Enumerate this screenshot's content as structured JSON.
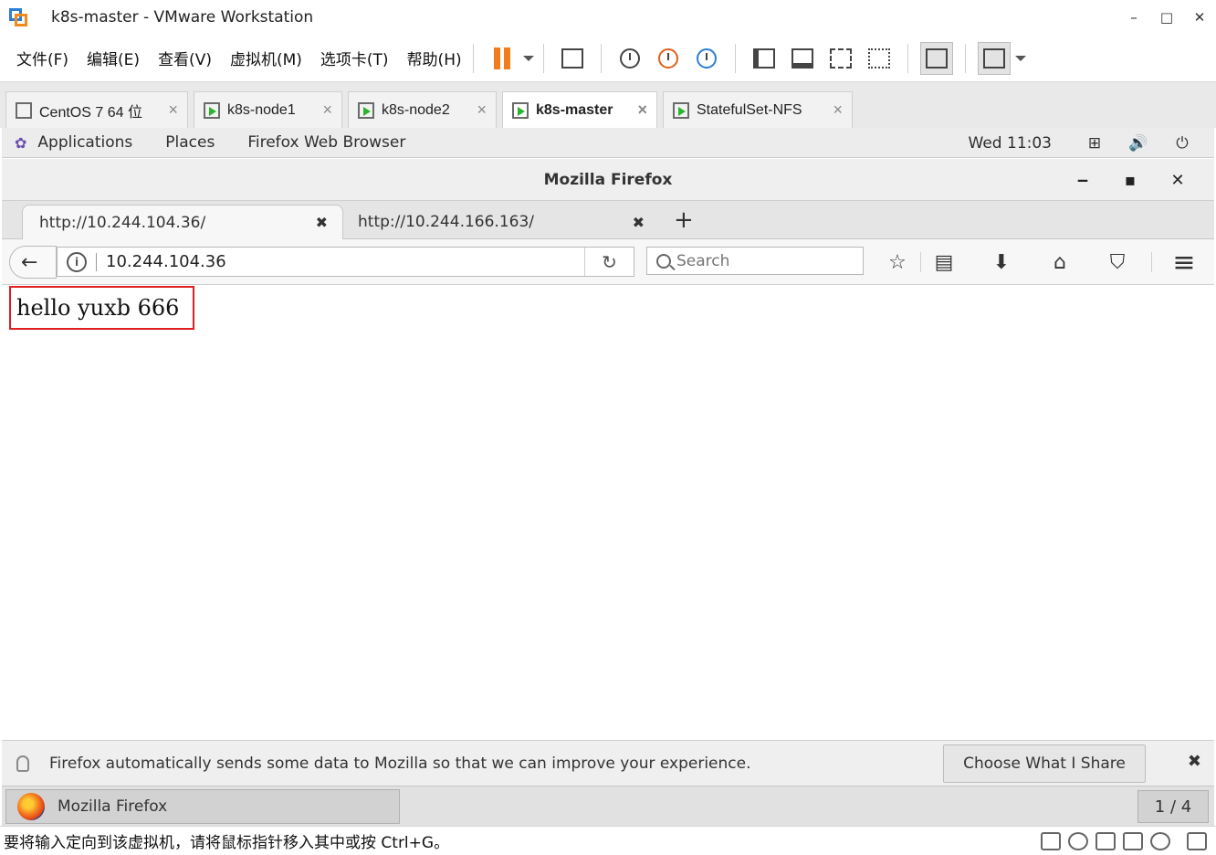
{
  "vmware": {
    "title": "k8s-master - VMware Workstation",
    "menu": [
      "文件(F)",
      "编辑(E)",
      "查看(V)",
      "虚拟机(M)",
      "选项卡(T)",
      "帮助(H)"
    ],
    "tabs": [
      {
        "label": "CentOS 7 64 位",
        "close": "×"
      },
      {
        "label": "k8s-node1",
        "close": "×"
      },
      {
        "label": "k8s-node2",
        "close": "×"
      },
      {
        "label": "k8s-master",
        "close": "×"
      },
      {
        "label": "StatefulSet-NFS",
        "close": "×"
      }
    ],
    "status_text": "要将输入定向到该虚拟机，请将鼠标指针移入其中或按 Ctrl+G。",
    "window_controls": {
      "minimize": "–",
      "maximize": "□",
      "close": "✕"
    }
  },
  "gnome": {
    "applications": "Applications",
    "places": "Places",
    "app_menu": "Firefox Web Browser",
    "clock": "Wed 11:03"
  },
  "firefox": {
    "window_title": "Mozilla Firefox",
    "window_controls": {
      "minimize": "‒",
      "maximize": "▪",
      "close": "✕"
    },
    "tabs": [
      {
        "label": "http://10.244.104.36/",
        "close": "✖"
      },
      {
        "label": "http://10.244.166.163/",
        "close": "✖"
      }
    ],
    "new_tab": "+",
    "url": "10.244.104.36",
    "search_placeholder": "Search",
    "page_text": "hello yuxb 666",
    "notification": {
      "text": "Firefox automatically sends some data to Mozilla so that we can improve your experience.",
      "button": "Choose What I Share",
      "close": "✖"
    },
    "taskbar_item": "Mozilla Firefox",
    "workspace": "1 / 4"
  },
  "icons": {
    "back": "←",
    "reload": "↻",
    "bookmark": "☆",
    "library": "▤",
    "download": "⬇",
    "home": "⌂",
    "pocket": "⛉",
    "menu": "≡",
    "network": "⊞",
    "volume": "🔊",
    "power": "⏻"
  }
}
